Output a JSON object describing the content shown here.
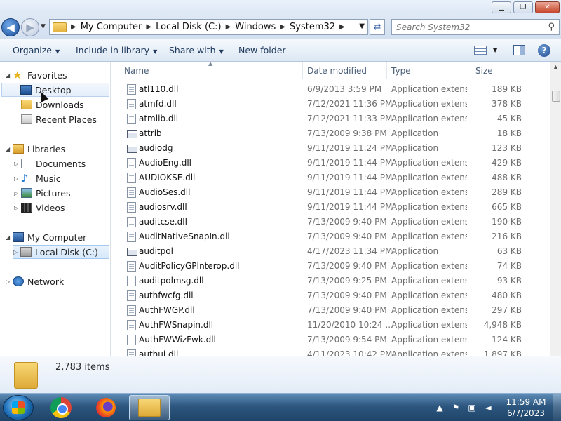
{
  "window": {
    "controls": {
      "minimize": "▁",
      "maximize": "❐",
      "close": "✕"
    }
  },
  "nav": {
    "back_icon": "back-arrow-icon",
    "forward_icon": "forward-arrow-icon",
    "breadcrumb": [
      "My Computer",
      "Local Disk (C:)",
      "Windows",
      "System32"
    ],
    "search_placeholder": "Search System32"
  },
  "toolbar": {
    "organize": "Organize",
    "include_in_library": "Include in library",
    "share_with": "Share with",
    "new_folder": "New folder"
  },
  "sidebar": {
    "favorites": {
      "label": "Favorites",
      "items": [
        "Desktop",
        "Downloads",
        "Recent Places"
      ]
    },
    "libraries": {
      "label": "Libraries",
      "items": [
        "Documents",
        "Music",
        "Pictures",
        "Videos"
      ]
    },
    "computer": {
      "label": "My Computer",
      "items": [
        "Local Disk (C:)"
      ]
    },
    "network": {
      "label": "Network"
    }
  },
  "columns": {
    "name": "Name",
    "date": "Date modified",
    "type": "Type",
    "size": "Size"
  },
  "files": [
    {
      "name": "atl110.dll",
      "date": "6/9/2013 3:59 PM",
      "type": "Application extens...",
      "size": "189 KB",
      "kind": "dll"
    },
    {
      "name": "atmfd.dll",
      "date": "7/12/2021 11:36 PM",
      "type": "Application extens...",
      "size": "378 KB",
      "kind": "dll"
    },
    {
      "name": "atmlib.dll",
      "date": "7/12/2021 11:33 PM",
      "type": "Application extens...",
      "size": "45 KB",
      "kind": "dll"
    },
    {
      "name": "attrib",
      "date": "7/13/2009 9:38 PM",
      "type": "Application",
      "size": "18 KB",
      "kind": "app"
    },
    {
      "name": "audiodg",
      "date": "9/11/2019 11:24 PM",
      "type": "Application",
      "size": "123 KB",
      "kind": "app"
    },
    {
      "name": "AudioEng.dll",
      "date": "9/11/2019 11:44 PM",
      "type": "Application extens...",
      "size": "429 KB",
      "kind": "dll"
    },
    {
      "name": "AUDIOKSE.dll",
      "date": "9/11/2019 11:44 PM",
      "type": "Application extens...",
      "size": "488 KB",
      "kind": "dll"
    },
    {
      "name": "AudioSes.dll",
      "date": "9/11/2019 11:44 PM",
      "type": "Application extens...",
      "size": "289 KB",
      "kind": "dll"
    },
    {
      "name": "audiosrv.dll",
      "date": "9/11/2019 11:44 PM",
      "type": "Application extens...",
      "size": "665 KB",
      "kind": "dll"
    },
    {
      "name": "auditcse.dll",
      "date": "7/13/2009 9:40 PM",
      "type": "Application extens...",
      "size": "190 KB",
      "kind": "dll"
    },
    {
      "name": "AuditNativeSnapIn.dll",
      "date": "7/13/2009 9:40 PM",
      "type": "Application extens...",
      "size": "216 KB",
      "kind": "dll"
    },
    {
      "name": "auditpol",
      "date": "4/17/2023 11:34 PM",
      "type": "Application",
      "size": "63 KB",
      "kind": "app"
    },
    {
      "name": "AuditPolicyGPInterop.dll",
      "date": "7/13/2009 9:40 PM",
      "type": "Application extens...",
      "size": "74 KB",
      "kind": "dll"
    },
    {
      "name": "auditpolmsg.dll",
      "date": "7/13/2009 9:25 PM",
      "type": "Application extens...",
      "size": "93 KB",
      "kind": "dll"
    },
    {
      "name": "authfwcfg.dll",
      "date": "7/13/2009 9:40 PM",
      "type": "Application extens...",
      "size": "480 KB",
      "kind": "dll"
    },
    {
      "name": "AuthFWGP.dll",
      "date": "7/13/2009 9:40 PM",
      "type": "Application extens...",
      "size": "297 KB",
      "kind": "dll"
    },
    {
      "name": "AuthFWSnapin.dll",
      "date": "11/20/2010 10:24 ...",
      "type": "Application extens...",
      "size": "4,948 KB",
      "kind": "dll"
    },
    {
      "name": "AuthFWWizFwk.dll",
      "date": "7/13/2009 9:54 PM",
      "type": "Application extens...",
      "size": "124 KB",
      "kind": "dll"
    },
    {
      "name": "authui.dll",
      "date": "4/11/2023 10:42 PM",
      "type": "Application extens...",
      "size": "1,897 KB",
      "kind": "dll"
    }
  ],
  "details": {
    "item_count": "2,783 items"
  },
  "taskbar": {
    "apps": [
      "chrome-icon",
      "firefox-icon",
      "explorer-icon"
    ],
    "time": "11:59 AM",
    "date": "6/7/2023"
  }
}
